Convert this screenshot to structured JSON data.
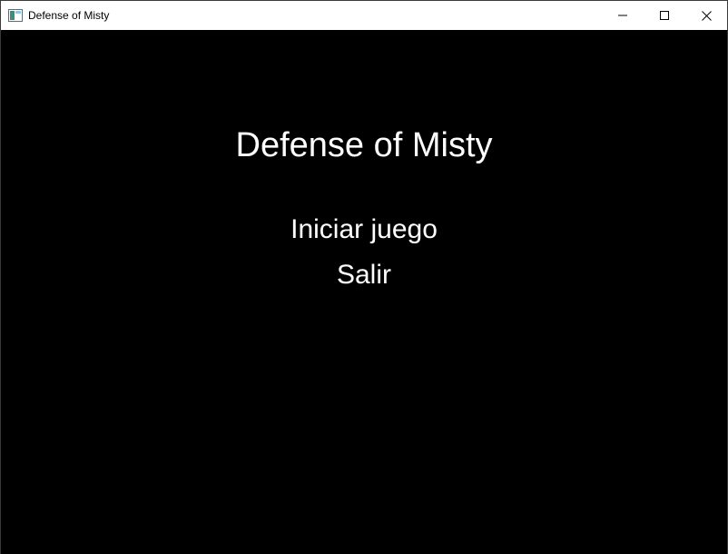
{
  "window": {
    "title": "Defense of Misty",
    "icons": {
      "app": "app-window-icon",
      "minimize": "minimize-icon",
      "maximize": "maximize-icon",
      "close": "close-icon"
    }
  },
  "game": {
    "title": "Defense of Misty",
    "menu": {
      "start_label": "Iniciar juego",
      "exit_label": "Salir"
    },
    "colors": {
      "background": "#000000",
      "text": "#ffffff"
    }
  }
}
